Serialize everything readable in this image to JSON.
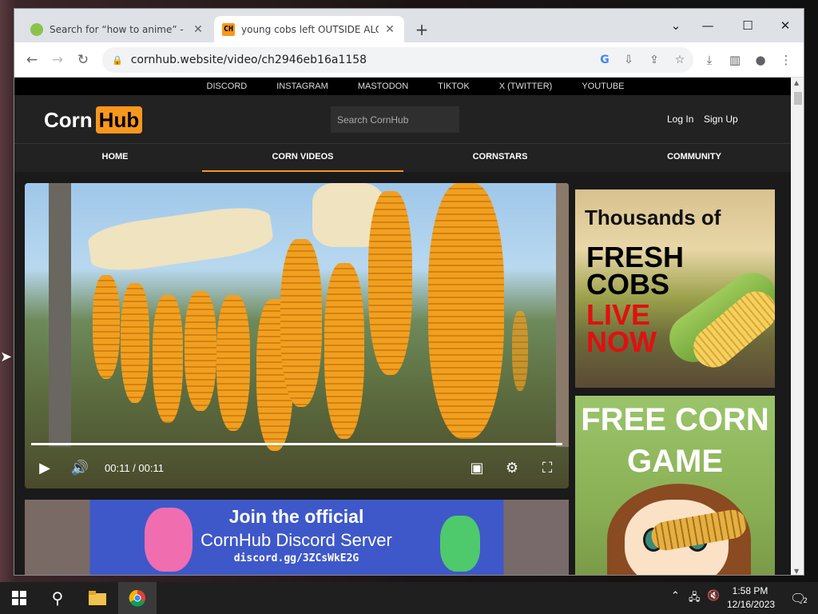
{
  "browser": {
    "tabs": [
      {
        "title": "Search for “how to anime” - wiki",
        "close": "✕"
      },
      {
        "title": "young cobs left OUTSIDE ALONE",
        "favicon_text": "CH",
        "close": "✕"
      }
    ],
    "new_tab": "+",
    "window_controls": {
      "minimize": "—",
      "maximize": "☐",
      "close": "✕",
      "tab_search": "⌄"
    },
    "url": "cornhub.website/video/ch2946eb16a1158"
  },
  "site": {
    "social_links": [
      "DISCORD",
      "INSTAGRAM",
      "MASTODON",
      "TIKTOK",
      "X (TWITTER)",
      "YOUTUBE"
    ],
    "logo": {
      "part1": "Corn",
      "part2": "Hub"
    },
    "search_placeholder": "Search CornHub",
    "login": "Log In",
    "signup": "Sign Up",
    "nav": [
      "HOME",
      "CORN VIDEOS",
      "CORNSTARS",
      "COMMUNITY"
    ],
    "active_nav": "CORN VIDEOS",
    "accent_color": "#f7971e"
  },
  "player": {
    "time": "00:11 / 00:11",
    "progress": 1.0
  },
  "ads": {
    "ad1": {
      "line1": "Thousands of",
      "line2": "FRESH COBS",
      "line3": "LIVE NOW"
    },
    "ad2": {
      "headline": "FREE CORN GAME"
    }
  },
  "banner": {
    "line1": "Join the official",
    "line2": "CornHub Discord Server",
    "line3": "discord.gg/3ZCsWkE2G"
  },
  "taskbar": {
    "time": "1:58 PM",
    "date": "12/16/2023",
    "notification_count": "2"
  }
}
